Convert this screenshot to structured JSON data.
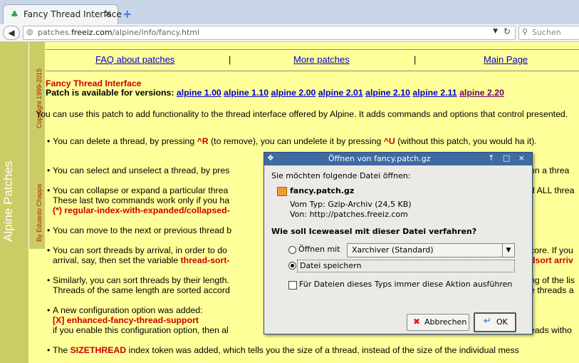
{
  "browser": {
    "tab_title": "Fancy Thread Interface",
    "tab_close": "×",
    "new_tab": "+",
    "url_prefix": "patches.",
    "url_domain": "freeiz.com",
    "url_path": "/alpine/info/fancy.html",
    "search_placeholder": "Suchen"
  },
  "sidebar": {
    "title": "Alpine Patches",
    "copyright": "Copyright 1999-2015",
    "author": "By Eduardo Chappa"
  },
  "topnav": {
    "faq": "FAQ about patches",
    "more": "More patches",
    "main": "Main Page",
    "sep": "|"
  },
  "content": {
    "title": "Fancy Thread Interface",
    "avail_prefix": "Patch is available for versions:",
    "versions": [
      "alpine 1.00",
      "alpine 1.10",
      "alpine 2.00",
      "alpine 2.01",
      "alpine 2.10",
      "alpine 2.11",
      "alpine 2.20"
    ],
    "intro": "You can use this patch to add functionality to the thread interface offered by Alpine. It adds commands and options that control presented.",
    "b1_a": "You can delete a thread, by pressing ",
    "b1_k1": "^R",
    "b1_b": " (to remove), you can undelete it by pressing ",
    "b1_k2": "^U",
    "b1_c": " (without this patch, you would ha it).",
    "b2_a": "You can select and unselect a thread, by pres",
    "b2_b": "on a threa",
    "b3_a": "You can collapse or expand a particular threa",
    "b3_b": "d ALL threa",
    "b3_c": "These last two commands work only if you ha",
    "b3_d": "(*) regular-index-with-expanded/collapsed-",
    "b4_a": "You can move to the next or previous thread b",
    "b5_a": "You can sort threads by arrival, in order to do",
    "b5_b": "core. If you",
    "b5_c": "arrival, say, then set the variable ",
    "b5_d": "thread-sort-",
    "b5_e": "dsort arriv",
    "b6_a": "Similarly, you can sort threads by their length.",
    "b6_b": "ng of the lis",
    "b6_c": "Threads of the same length are sorted accord",
    "b6_d": "e threads a",
    "b7_a": "A new configuration option was added:",
    "b7_b": "[X] enhanced-fancy-thread-support",
    "b7_c": "if you enable this configuration option, then al",
    "b7_d": "eads witho",
    "b8_a": "The ",
    "b8_b": "SIZETHREAD",
    "b8_c": " index token was added, which tells you the size of a thread, instead of the size of the individual mess"
  },
  "dialog": {
    "title": "Öffnen von fancy.patch.gz",
    "controls": "↑ □ ×",
    "question": "Sie möchten folgende Datei öffnen:",
    "filename": "fancy.patch.gz",
    "type_line": "Vom Typ: Gzip-Archiv (24,5 KB)",
    "from_line": "Von: http://patches.freeiz.com",
    "prompt": "Wie soll Iceweasel mit dieser Datei verfahren?",
    "open_with": "Öffnen mit",
    "open_app": "Xarchiver (Standard)",
    "save_file": "Datei speichern",
    "always": "Für Dateien dieses Typs immer diese Aktion ausführen",
    "cancel": "Abbrechen",
    "ok": "OK",
    "selected_option": "save",
    "always_checked": false
  }
}
